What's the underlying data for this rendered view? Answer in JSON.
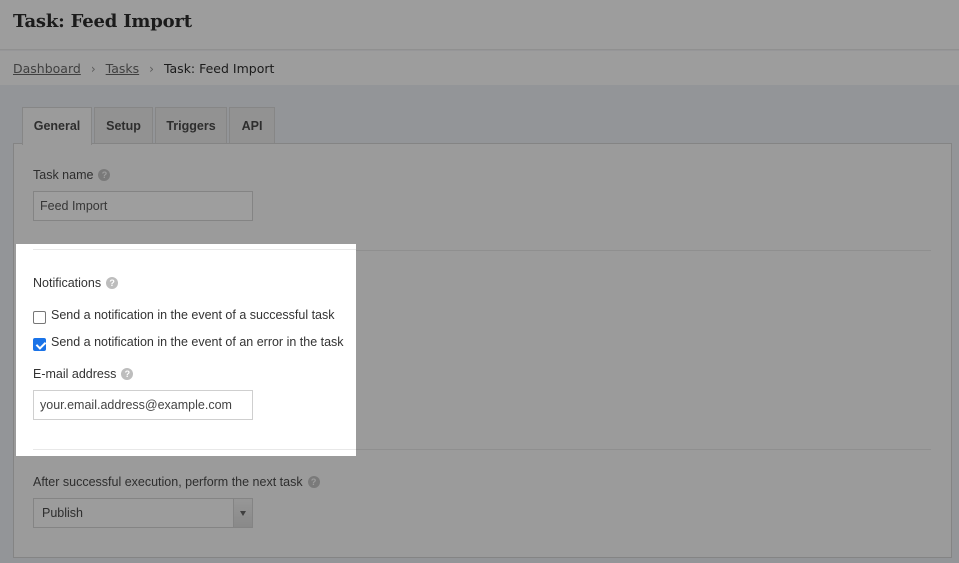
{
  "header": {
    "title": "Task: Feed Import"
  },
  "breadcrumb": {
    "items": [
      {
        "label": "Dashboard",
        "link": true
      },
      {
        "label": "Tasks",
        "link": true
      },
      {
        "label": "Task: Feed Import",
        "link": false
      }
    ],
    "separator": "›"
  },
  "tabs": [
    {
      "label": "General",
      "active": true
    },
    {
      "label": "Setup",
      "active": false
    },
    {
      "label": "Triggers",
      "active": false
    },
    {
      "label": "API",
      "active": false
    }
  ],
  "general": {
    "task_name": {
      "label": "Task name",
      "value": "Feed Import",
      "help_icon": "question-mark"
    },
    "notifications": {
      "label": "Notifications",
      "help_icon": "question-mark",
      "options": [
        {
          "label": "Send a notification in the event of a successful task",
          "checked": false
        },
        {
          "label": "Send a notification in the event of an error in the task",
          "checked": true
        }
      ],
      "email": {
        "label": "E-mail address",
        "help_icon": "question-mark",
        "value": "your.email.address@example.com"
      }
    },
    "next_task": {
      "label": "After successful execution, perform the next task",
      "help_icon": "question-mark",
      "selected": "Publish"
    }
  },
  "icons": {
    "help": "?",
    "breadcrumb_separator": "chevron-right",
    "select_arrow": "triangle-down"
  },
  "colors": {
    "checkbox_checked": "#1a73e8",
    "overlay": "#282828"
  }
}
